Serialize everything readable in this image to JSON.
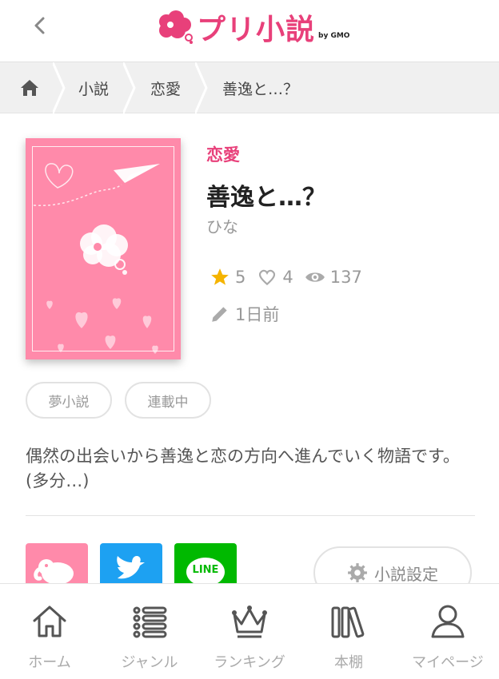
{
  "header": {
    "logo_text": "プリ小説",
    "logo_by": "by GMO"
  },
  "breadcrumb": [
    {
      "label": "小説"
    },
    {
      "label": "恋愛"
    },
    {
      "label": "善逸と…？"
    }
  ],
  "novel": {
    "genre": "恋愛",
    "title": "善逸と…？",
    "author": "ひな",
    "stars": "5",
    "likes": "4",
    "views": "137",
    "updated": "1日前",
    "tags": [
      "夢小説",
      "連載中"
    ],
    "description": "偶然の出会いから善逸と恋の方向へ進んでいく物語です。(多分…)"
  },
  "share": {
    "line_label": "LINE",
    "settings_label": "小説設定"
  },
  "colors": {
    "brand": "#e8407a",
    "cover": "#ff8aaa",
    "twitter": "#1da1f2",
    "line": "#00b900",
    "star": "#f5b400"
  },
  "bottom_nav": [
    {
      "label": "ホーム",
      "icon": "home-icon"
    },
    {
      "label": "ジャンル",
      "icon": "list-icon"
    },
    {
      "label": "ランキング",
      "icon": "crown-icon"
    },
    {
      "label": "本棚",
      "icon": "bookshelf-icon"
    },
    {
      "label": "マイページ",
      "icon": "person-icon"
    }
  ]
}
